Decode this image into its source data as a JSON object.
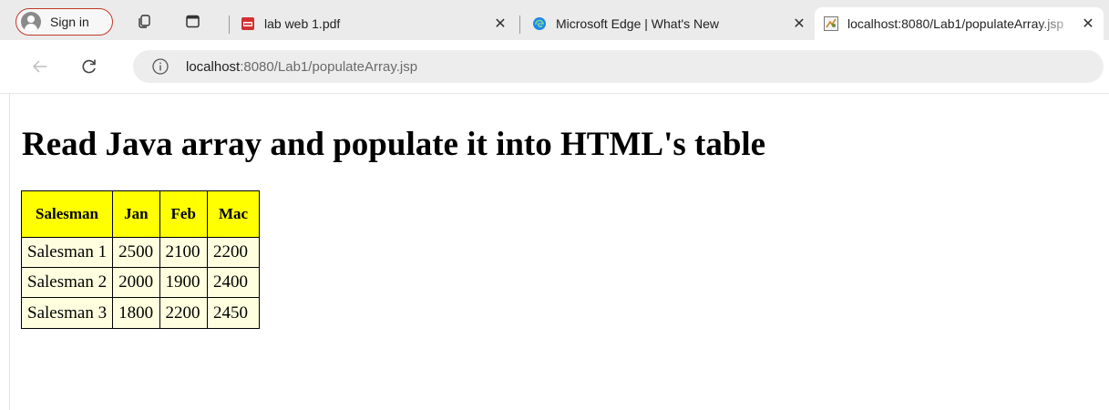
{
  "browser": {
    "signin_label": "Sign in",
    "tabs": [
      {
        "title": "lab web 1.pdf",
        "close": "✕"
      },
      {
        "title": "Microsoft Edge | What's New",
        "close": "✕"
      },
      {
        "title": "localhost:8080/Lab1/populateArray.jsp",
        "close": "✕"
      }
    ],
    "address": {
      "host": "localhost",
      "path": ":8080/Lab1/populateArray.jsp"
    },
    "colors": {
      "signin_border": "#c0392b",
      "pdf_icon": "#d32f2f",
      "edge_icon": "#1e88e5"
    }
  },
  "page": {
    "title": "Read Java array and populate it into HTML's table",
    "table": {
      "headers": [
        "Salesman",
        "Jan",
        "Feb",
        "Mac"
      ],
      "rows": [
        [
          "Salesman 1",
          "2500",
          "2100",
          "2200"
        ],
        [
          "Salesman 2",
          "2000",
          "1900",
          "2400"
        ],
        [
          "Salesman 3",
          "1800",
          "2200",
          "2450"
        ]
      ],
      "header_color": "#ffff00",
      "cell_color": "#ffffe0"
    }
  }
}
